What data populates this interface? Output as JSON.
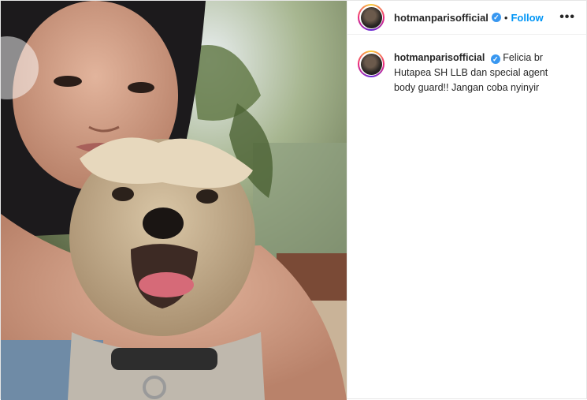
{
  "post": {
    "username": "hotmanparisofficial",
    "follow_label": "Follow",
    "separator": "•",
    "more_label": "•••",
    "caption_text": "Felicia br Hutapea SH LLB dan special agent body guard!! Jangan coba nyinyir"
  },
  "colors": {
    "follow": "#0095f6",
    "verified": "#3897f0"
  }
}
